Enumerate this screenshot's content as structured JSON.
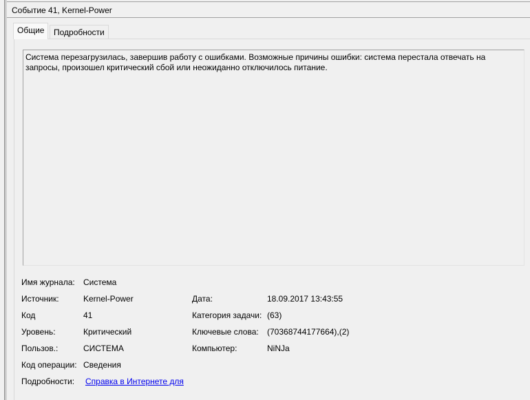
{
  "window": {
    "title": "Событие 41, Kernel-Power"
  },
  "tabs": [
    {
      "label": "Общие"
    },
    {
      "label": "Подробности"
    }
  ],
  "description": "Система перезагрузилась, завершив работу с ошибками. Возможные причины ошибки: система перестала отвечать на запросы, произошел критический сбой или неожиданно отключилось питание.",
  "fields": {
    "log_name": {
      "label": "Имя журнала:",
      "value": "Система"
    },
    "source": {
      "label": "Источник:",
      "value": "Kernel-Power"
    },
    "date": {
      "label": "Дата:",
      "value": "18.09.2017 13:43:55"
    },
    "event_id": {
      "label": "Код",
      "value": "41"
    },
    "task_category": {
      "label": "Категория задачи:",
      "value": "(63)"
    },
    "level": {
      "label": "Уровень:",
      "value": "Критический"
    },
    "keywords": {
      "label": "Ключевые слова:",
      "value": "(70368744177664),(2)"
    },
    "user": {
      "label": "Пользов.:",
      "value": "СИСТЕМА"
    },
    "computer": {
      "label": "Компьютер:",
      "value": "NiNJa"
    },
    "opcode": {
      "label": "Код операции:",
      "value": "Сведения"
    },
    "more_info": {
      "label": "Подробности:",
      "value": "Справка в Интернете для "
    }
  }
}
